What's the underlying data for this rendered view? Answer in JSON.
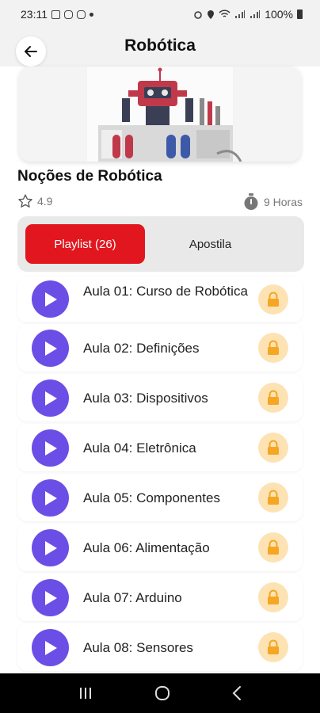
{
  "status_bar": {
    "time": "23:11",
    "battery": "100%"
  },
  "header": {
    "title": "Robótica"
  },
  "course": {
    "title": "Noções de Robótica",
    "rating": "4.9",
    "duration": "9 Horas"
  },
  "tabs": [
    {
      "label": "Playlist (26)",
      "active": true
    },
    {
      "label": "Apostila",
      "active": false
    }
  ],
  "lessons": [
    {
      "title": "Aula 01: Curso de Robótica",
      "locked": true
    },
    {
      "title": "Aula 02: Definições",
      "locked": true
    },
    {
      "title": "Aula 03: Dispositivos",
      "locked": true
    },
    {
      "title": "Aula 04: Eletrônica",
      "locked": true
    },
    {
      "title": "Aula 05: Componentes",
      "locked": true
    },
    {
      "title": "Aula 06: Alimentação",
      "locked": true
    },
    {
      "title": "Aula 07: Arduino",
      "locked": true
    },
    {
      "title": "Aula 08: Sensores",
      "locked": true
    }
  ],
  "colors": {
    "accent": "#e2161f",
    "play": "#6b4ee6",
    "lock_bg": "#fde3b4",
    "lock_icon": "#f5a623"
  },
  "icons": {
    "back": "arrow-left-icon",
    "star": "star-outline-icon",
    "timer": "stopwatch-icon",
    "play": "play-icon",
    "lock": "lock-icon",
    "nav": [
      "recent-apps-icon",
      "home-icon",
      "back-nav-icon"
    ]
  }
}
